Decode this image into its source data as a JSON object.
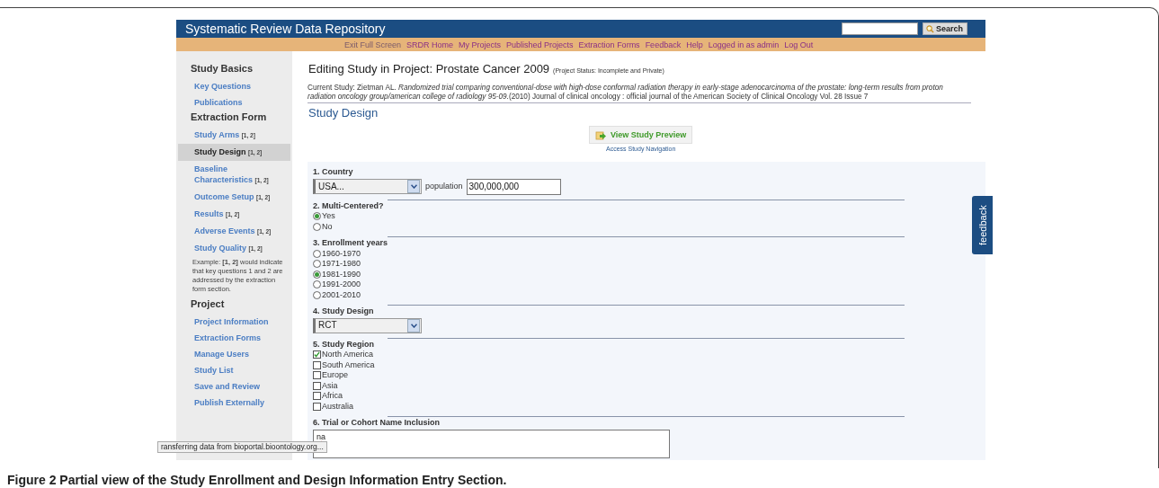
{
  "header": {
    "title": "Systematic Review Data Repository",
    "search_button": "Search"
  },
  "nav": [
    "Exit Full Screen",
    "SRDR Home",
    "My Projects",
    "Published Projects",
    "Extraction Forms",
    "Feedback",
    "Help",
    "Logged in as admin",
    "Log Out"
  ],
  "sidebar": {
    "sections": [
      {
        "heading": "Study Basics",
        "items": [
          {
            "label": "Key Questions",
            "selected": false
          },
          {
            "label": "Publications",
            "selected": false
          }
        ]
      },
      {
        "heading": "Extraction Form",
        "items": [
          {
            "label": "Study Arms",
            "note": "[1, 2]",
            "selected": false
          },
          {
            "label": "Study Design",
            "note": "[1, 2]",
            "selected": true
          },
          {
            "label": "Baseline Characteristics",
            "note": "[1, 2]",
            "selected": false
          },
          {
            "label": "Outcome Setup",
            "note": "[1, 2]",
            "selected": false
          },
          {
            "label": "Results",
            "note": "[1, 2]",
            "selected": false
          },
          {
            "label": "Adverse Events",
            "note": "[1, 2]",
            "selected": false
          },
          {
            "label": "Study Quality",
            "note": "[1, 2]",
            "selected": false
          }
        ],
        "footnote": "Example: **[1, 2]** would indicate that key questions 1 and 2 are addressed by the extraction form section."
      },
      {
        "heading": "Project",
        "items": [
          {
            "label": "Project Information",
            "selected": false
          },
          {
            "label": "Extraction Forms",
            "selected": false
          },
          {
            "label": "Manage Users",
            "selected": false
          },
          {
            "label": "Study List",
            "selected": false
          },
          {
            "label": "Save and Review",
            "selected": false
          },
          {
            "label": "Publish Externally",
            "selected": false
          }
        ]
      }
    ]
  },
  "main": {
    "title": "Editing Study in Project: Prostate Cancer 2009",
    "status": "(Project Status: Incomplete and Private)",
    "current_study": "Current Study: Zietman AL. *Randomized trial comparing conventional-dose with high-dose conformal radiation therapy in early-stage adenocarcinoma of the prostate: long-term results from proton radiation oncology group/american college of radiology 95-09.*(2010) Journal of clinical oncology : official journal of the American Society of Clinical Oncology Vol. 28 Issue 7",
    "section_title": "Study Design",
    "preview_button": "View Study Preview",
    "navigation_link": "Access Study Navigation"
  },
  "form": {
    "questions": [
      {
        "kind": "select",
        "label": "1. Country",
        "value": "USA...",
        "extra_label": "population",
        "extra_value": "300,000,000"
      },
      {
        "kind": "radio",
        "label": "2. Multi-Centered?",
        "options": [
          {
            "label": "Yes",
            "selected": true
          },
          {
            "label": "No",
            "selected": false
          }
        ]
      },
      {
        "kind": "radio",
        "label": "3. Enrollment years",
        "options": [
          {
            "label": "1960-1970",
            "selected": false
          },
          {
            "label": "1971-1980",
            "selected": false
          },
          {
            "label": "1981-1990",
            "selected": true
          },
          {
            "label": "1991-2000",
            "selected": false
          },
          {
            "label": "2001-2010",
            "selected": false
          }
        ]
      },
      {
        "kind": "select",
        "label": "4. Study Design",
        "value": "RCT"
      },
      {
        "kind": "checkbox",
        "label": "5. Study Region",
        "options": [
          {
            "label": "North America",
            "checked": true
          },
          {
            "label": "South America",
            "checked": false
          },
          {
            "label": "Europe",
            "checked": false
          },
          {
            "label": "Asia",
            "checked": false
          },
          {
            "label": "Africa",
            "checked": false
          },
          {
            "label": "Australia",
            "checked": false
          }
        ]
      },
      {
        "kind": "textarea",
        "label": "6. Trial or Cohort Name Inclusion",
        "value": "na"
      }
    ]
  },
  "feedback_tab": "feedback",
  "status_bar": "ransferring data from bioportal.bioontology.org...",
  "caption": "Figure 2 Partial view of the Study Enrollment and Design Information Entry Section."
}
